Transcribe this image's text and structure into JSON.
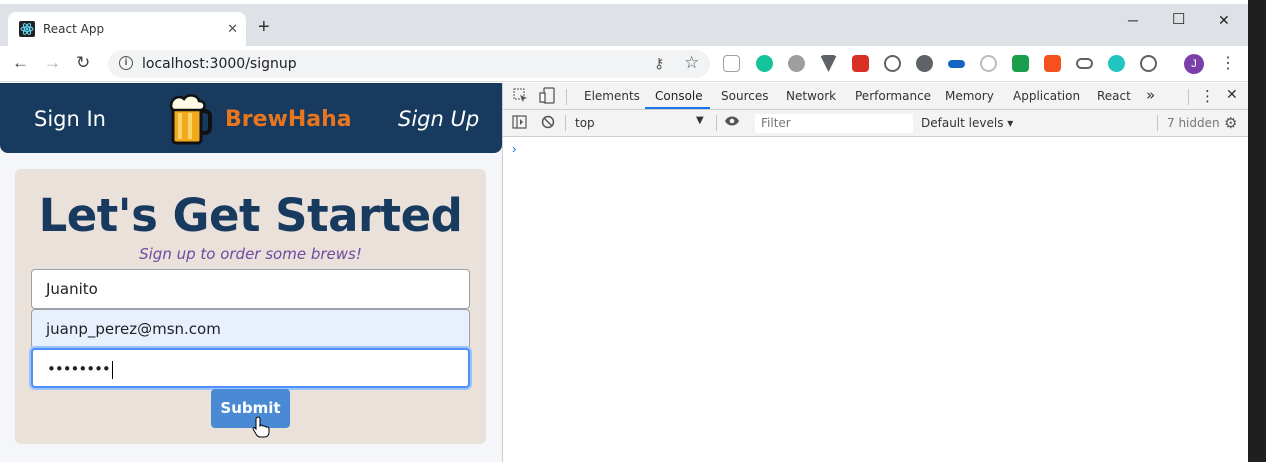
{
  "browser": {
    "tab_title": "React App",
    "tab_close": "✕",
    "new_tab": "+",
    "url": "localhost:3000/signup",
    "window_minimize": "─",
    "window_maximize": "☐",
    "window_close": "✕",
    "profile_initial": "J",
    "extension_colors": [
      "#9aa0a6",
      "#15c39a",
      "#9e9e9e",
      "#5f6368",
      "#d93025",
      "#5f6368",
      "#5f6368",
      "#1565c0",
      "#bdbdbd",
      "#1b9e4b",
      "#f4511e",
      "#5f6368",
      "#20c5c0",
      "#5f6368"
    ]
  },
  "app": {
    "nav": {
      "signin": "Sign In",
      "brand": "BrewHaha",
      "signup": "Sign Up"
    },
    "form": {
      "heading": "Let's Get Started",
      "subheading": "Sign up to order some brews!",
      "name_value": "Juanito",
      "email_value": "juanp_perez@msn.com",
      "password_value": "••••••••",
      "submit_label": "Submit"
    },
    "colors": {
      "nav_bg": "#173a5e",
      "brand": "#e8761e",
      "card_bg": "#e9e1da",
      "submit_bg": "#4a8ad4",
      "subheading": "#6f4aa0"
    }
  },
  "devtools": {
    "tabs": [
      "Elements",
      "Console",
      "Sources",
      "Network",
      "Performance",
      "Memory",
      "Application",
      "React"
    ],
    "active_tab": "Console",
    "more_tabs": "»",
    "context": "top",
    "filter_placeholder": "Filter",
    "levels": "Default levels ▾",
    "hidden_count": "7 hidden",
    "prompt": "›"
  }
}
